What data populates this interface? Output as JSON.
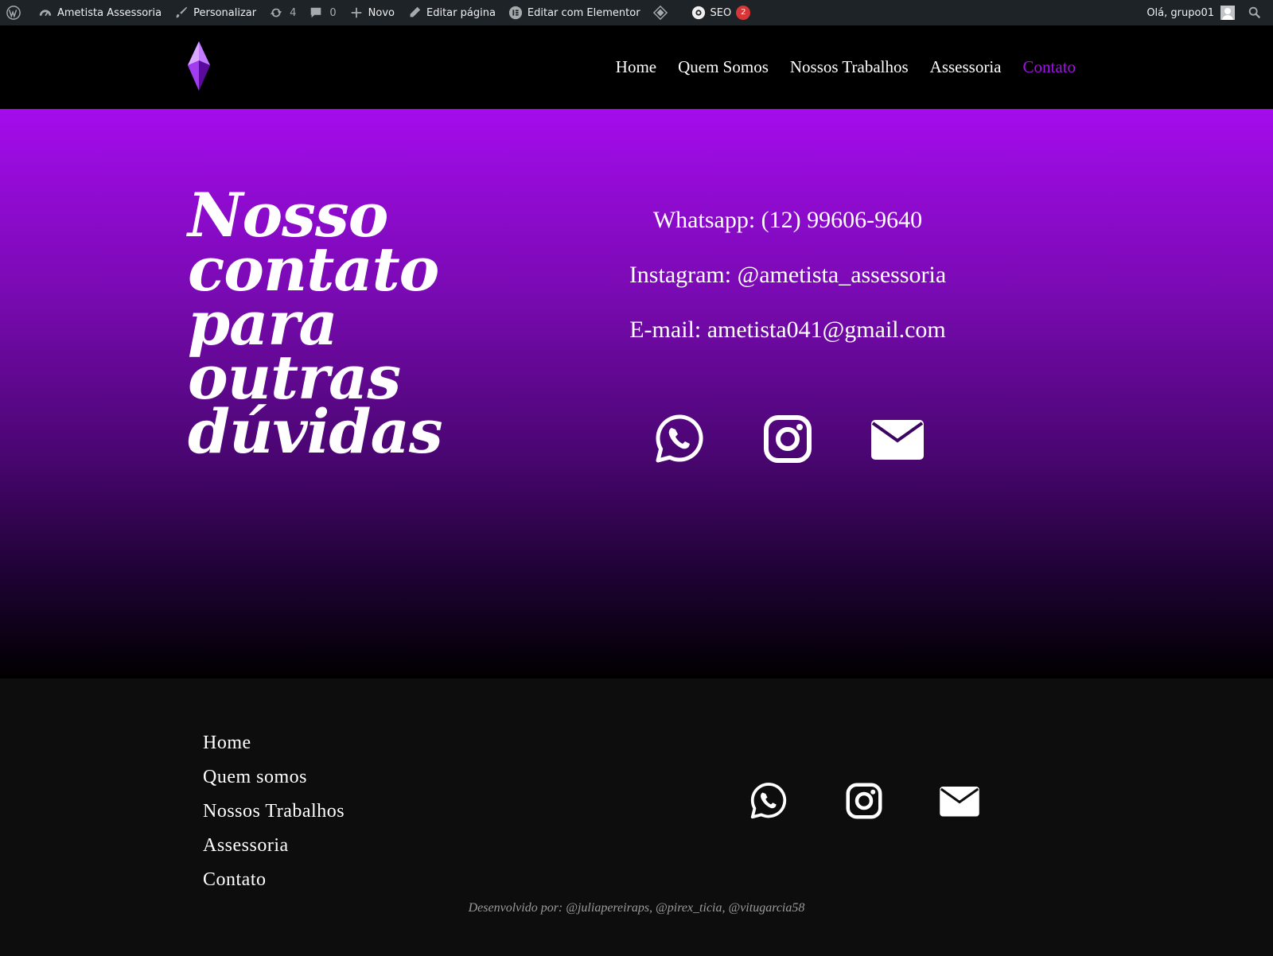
{
  "adminbar": {
    "site_name": "Ametista Assessoria",
    "customize": "Personalizar",
    "updates_count": "4",
    "comments_count": "0",
    "new": "Novo",
    "edit_page": "Editar página",
    "edit_elementor": "Editar com Elementor",
    "seo": "SEO",
    "seo_badge": "2",
    "greeting": "Olá, grupo01"
  },
  "header": {
    "nav": [
      "Home",
      "Quem Somos",
      "Nossos Trabalhos",
      "Assessoria",
      "Contato"
    ],
    "active_item": "Contato",
    "accent_color": "#a110e6"
  },
  "hero": {
    "title_lines": [
      "Nosso",
      "contato",
      "para",
      "outras",
      "dúvidas"
    ],
    "whatsapp": "Whatsapp: (12) 99606-9640",
    "instagram": "Instagram: @ametista_assessoria",
    "email": "E-mail: ametista041@gmail.com",
    "icons": [
      "whatsapp-icon",
      "instagram-icon",
      "envelope-icon"
    ]
  },
  "footer": {
    "nav": [
      "Home",
      "Quem somos",
      "Nossos Trabalhos",
      "Assessoria",
      "Contato"
    ],
    "credits": "Desenvolvido por: @juliapereiraps, @pirex_ticia, @vitugarcia58",
    "icons": [
      "whatsapp-icon",
      "instagram-icon",
      "envelope-icon"
    ]
  }
}
